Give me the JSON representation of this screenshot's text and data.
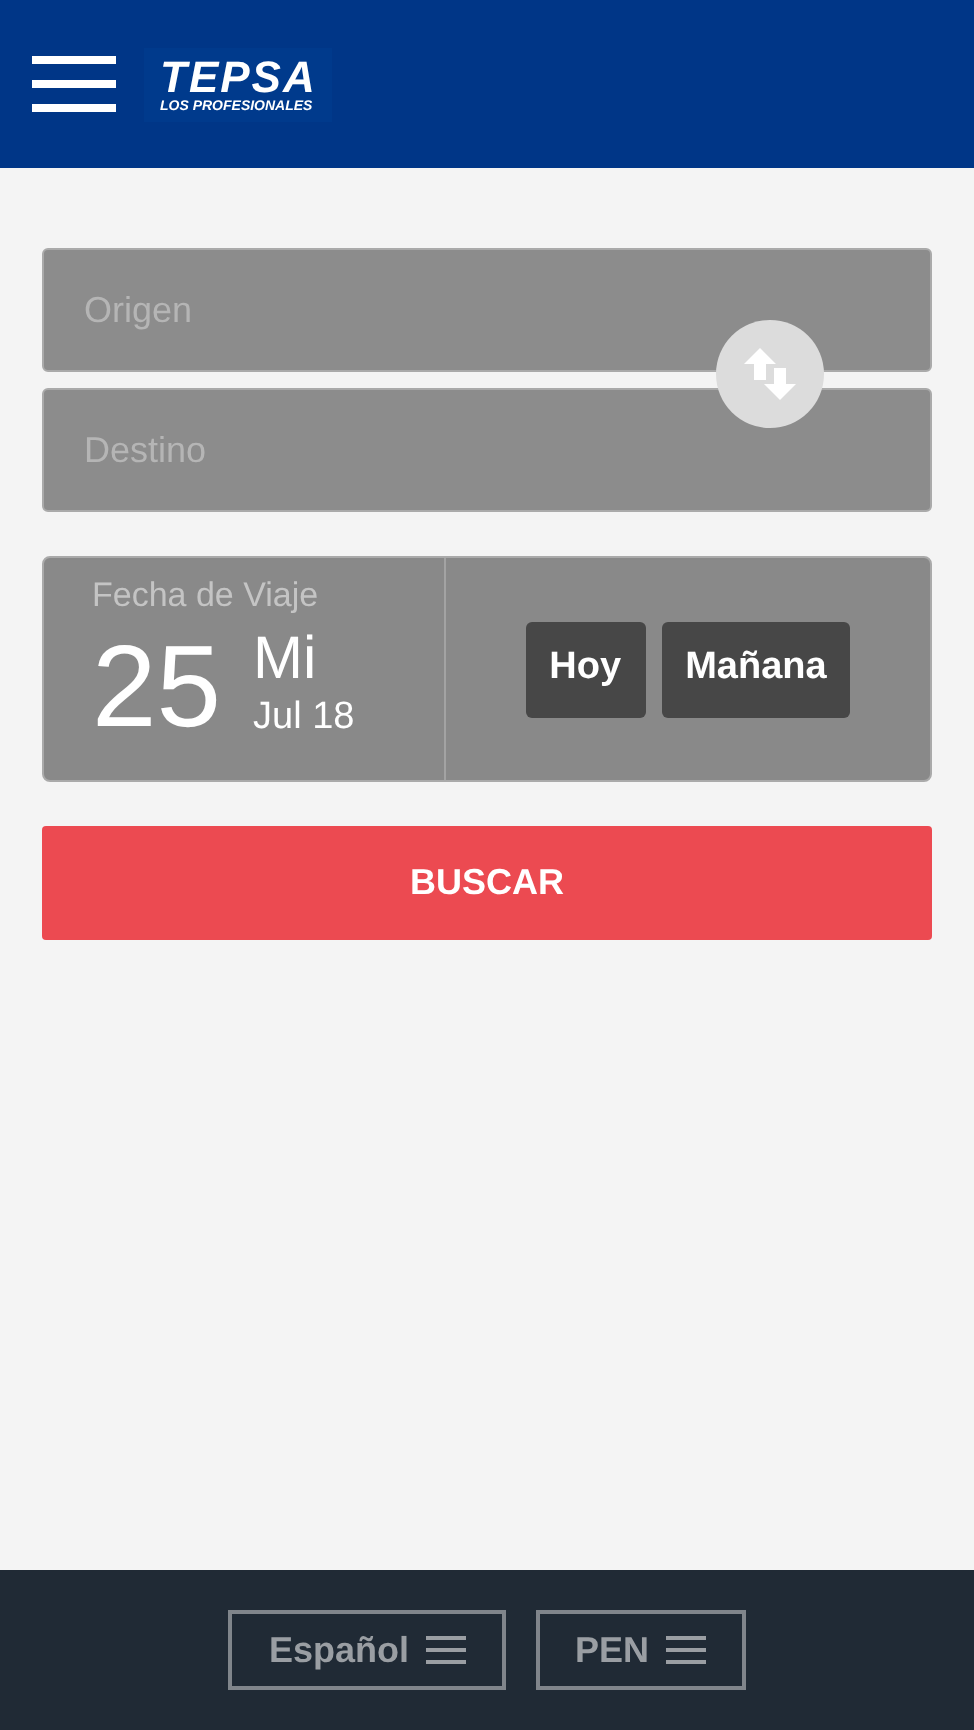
{
  "header": {
    "logo_title": "TEPSA",
    "logo_subtitle": "LOS PROFESIONALES"
  },
  "origin": {
    "placeholder": "Origen"
  },
  "destination": {
    "placeholder": "Destino"
  },
  "date": {
    "label": "Fecha de Viaje",
    "day": "25",
    "weekday": "Mi",
    "month_year": "Jul 18"
  },
  "quick_dates": [
    "Hoy",
    "Mañana"
  ],
  "search_button": "BUSCAR",
  "footer": {
    "language": "Español",
    "currency": "PEN"
  }
}
